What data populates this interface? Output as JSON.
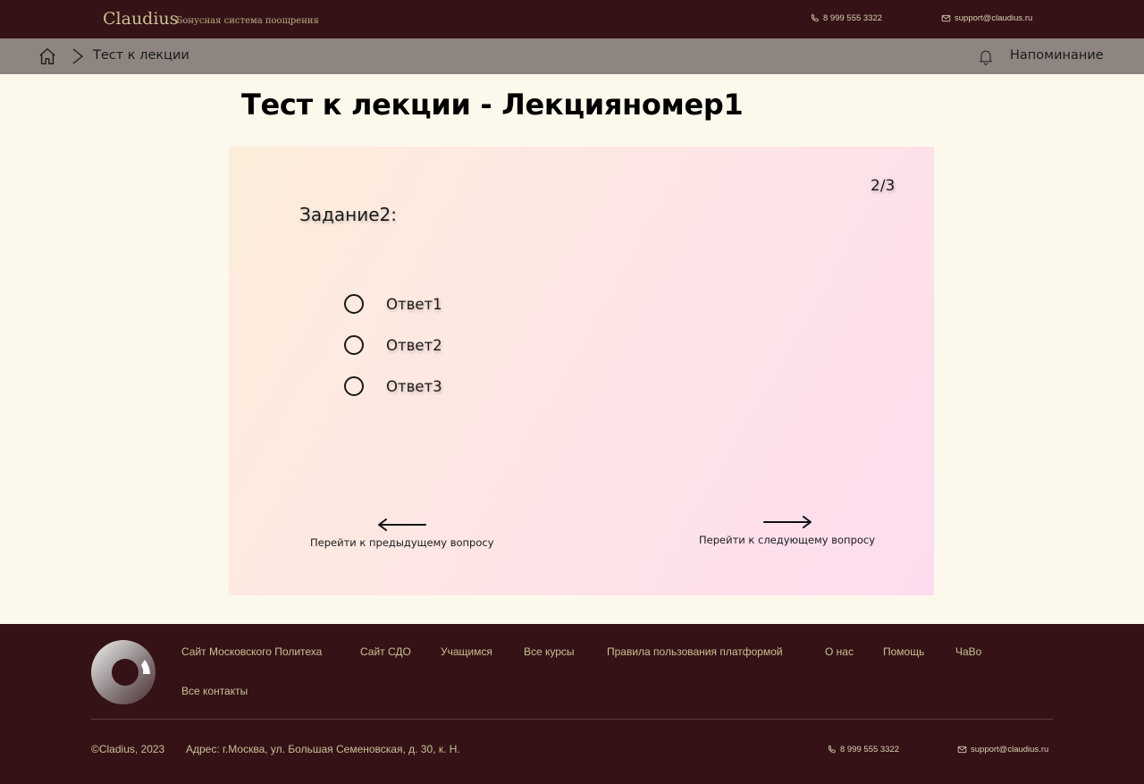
{
  "header": {
    "brand": "Claudius",
    "brand_sub": "Бонусная система поощрения",
    "phone": "8 999 555 3322",
    "email": "support@claudius.ru"
  },
  "breadcrumb": {
    "current": "Тест к лекции",
    "reminder": "Напоминание"
  },
  "page": {
    "title": "Тест к лекции - Лекцияномер1"
  },
  "quiz": {
    "counter": "2/3",
    "task": "Задание2:",
    "options": [
      {
        "label": "Ответ1",
        "selected": false
      },
      {
        "label": "Ответ2",
        "selected": false
      },
      {
        "label": "Ответ3",
        "selected": false
      }
    ],
    "prev_label": "Перейти к предыдущему вопросу",
    "next_label": "Перейти к следующему вопросу"
  },
  "footer": {
    "links": [
      "Сайт Московского Политеха",
      "Сайт СДО",
      "Учащимся",
      "Все курсы",
      "Правила пользования платформой",
      "О нас",
      "Помощь",
      "ЧаВо",
      "Все контакты"
    ],
    "copyright": "©Cladius, 2023",
    "address": "Адрес: г.Москва, ул. Большая Семеновская, д. 30, к. Н.",
    "phone": "8 999 555 3322",
    "email": "support@claudius.ru"
  },
  "colors": {
    "header_bg": "#341216",
    "breadcrumb_bg": "#8e8581",
    "page_bg": "#fdf8ec",
    "footer_text": "#c9c093"
  }
}
